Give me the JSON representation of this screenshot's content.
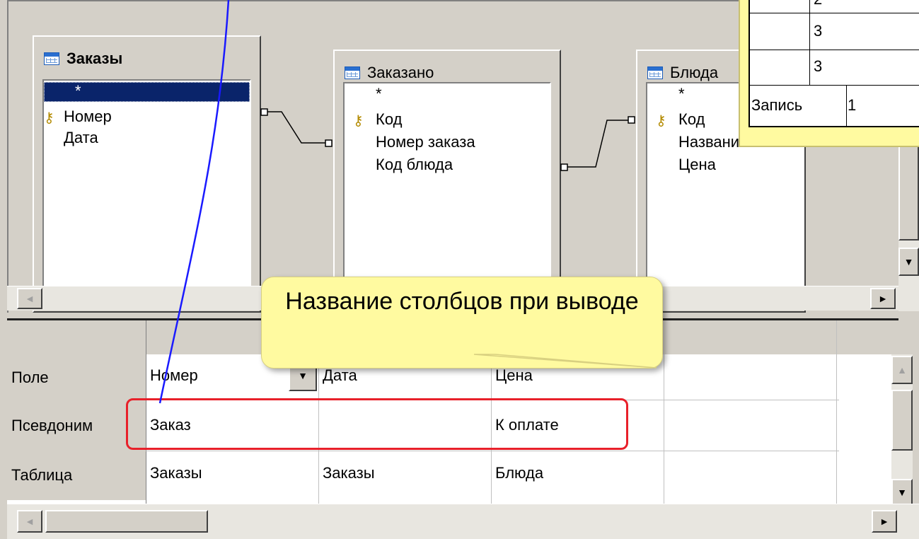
{
  "tables": {
    "orders": {
      "title": "Заказы",
      "fields": [
        "*",
        "Номер",
        "Дата"
      ]
    },
    "ordered": {
      "title": "Заказано",
      "fields": [
        "*",
        "Код",
        "Номер заказа",
        "Код блюда"
      ]
    },
    "dishes": {
      "title": "Блюда",
      "fields": [
        "*",
        "Код",
        "Название",
        "Цена"
      ]
    }
  },
  "grid": {
    "row_labels": [
      "Поле",
      "Псевдоним",
      "Таблица"
    ],
    "columns": [
      {
        "field": "Номер",
        "alias": "Заказ",
        "table": "Заказы"
      },
      {
        "field": "Дата",
        "alias": "",
        "table": "Заказы"
      },
      {
        "field": "Цена",
        "alias": "К оплате",
        "table": "Блюда"
      },
      {
        "field": "",
        "alias": "",
        "table": ""
      }
    ]
  },
  "popup": {
    "values": [
      "2",
      "3",
      "3"
    ],
    "record_label": "Запись",
    "record_value": "1"
  },
  "callout": {
    "text": "Название столбцов при выводе"
  },
  "colors": {
    "callout_bg": "#fffaa0",
    "highlight": "#e8202a",
    "arrow": "#1a1aff",
    "selection": "#0a246a"
  },
  "icons": [
    "table-icon",
    "key-icon",
    "scroll-left-icon",
    "scroll-right-icon",
    "scroll-up-icon",
    "scroll-down-icon",
    "dropdown-arrow-icon"
  ]
}
